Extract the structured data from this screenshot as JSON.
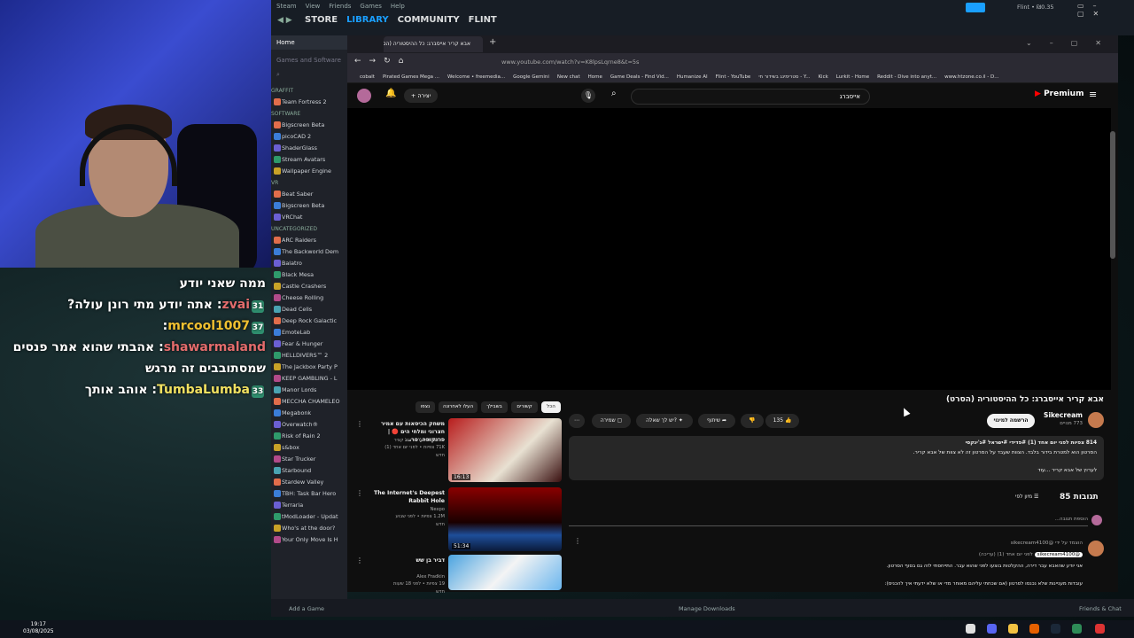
{
  "chat": {
    "lines": [
      {
        "text": "ממה שאני יודע"
      },
      {
        "user": "zvai",
        "badge": "31",
        "text": ": אתה יודע מתי רונן עולה?"
      },
      {
        "user": "mrcool1007",
        "badge": "37",
        "text": ":"
      },
      {
        "user": "shawarmaland",
        "text": ": אהבתי שהוא אמר פנסים"
      },
      {
        "text": "שמסתובבים זה מרגש"
      },
      {
        "user": "TumbaLumba",
        "badge": "33",
        "text": ": אוהב אותך"
      }
    ]
  },
  "steam": {
    "menu": [
      "Steam",
      "View",
      "Friends",
      "Games",
      "Help"
    ],
    "nav": [
      "STORE",
      "LIBRARY",
      "COMMUNITY",
      "FLINT"
    ],
    "user": "Flint • ₪0.35",
    "home": "Home",
    "filter": "Games and Software",
    "categories": [
      {
        "name": "GRAFFIT",
        "items": [
          "Team Fortress 2"
        ]
      },
      {
        "name": "SOFTWARE",
        "count": "(5/5)",
        "items": [
          "Bigscreen Beta",
          "picoCAD 2",
          "ShaderGlass",
          "Stream Avatars",
          "Wallpaper Engine"
        ]
      },
      {
        "name": "VR",
        "count": "(3/3)",
        "items": [
          "Beat Saber",
          "Bigscreen Beta",
          "VRChat"
        ]
      },
      {
        "name": "UNCATEGORIZED",
        "count": "(27/27)",
        "items": [
          "ARC Raiders",
          "The Backworld Dem",
          "Balatro",
          "Black Mesa",
          "Castle Crashers",
          "Cheese Rolling",
          "Dead Cells",
          "Deep Rock Galactic",
          "EmoteLab",
          "Fear & Hunger",
          "HELLDIVERS™ 2",
          "The Jackbox Party P",
          "KEEP GAMBLING - L",
          "Manor Lords",
          "MECCHA CHAMELEO",
          "Megabonk",
          "Overwatch®",
          "Risk of Rain 2",
          "s&box",
          "Star Trucker",
          "Starbound",
          "Stardew Valley",
          "TBH: Task Bar Hero",
          "Terraria",
          "tModLoader - Updat",
          "Who's at the door?",
          "Your Only Move Is H"
        ]
      }
    ],
    "bottom": {
      "add_game": "Add a Game",
      "downloads": "Manage Downloads",
      "friends": "Friends & Chat"
    }
  },
  "browser": {
    "tab_title": "אבא קריר אייסברג: כל ההיסטוריה (הסרט)",
    "url": "www.youtube.com/watch?v=K8lpsLqrne8&t=5s",
    "bookmarks": [
      "cobalt",
      "Pirated Games Mega ...",
      "Welcome • freemedia...",
      "Google Gemini",
      "New chat",
      "Home",
      "Game Deals - Find Vid...",
      "Humanize AI",
      "Flint - YouTube",
      "סטרימינג בשידור חי - Y...",
      "Kick",
      "Lurkit - Home",
      "Reddit - Dive into anyt...",
      "www.htzone.co.il - D..."
    ]
  },
  "youtube": {
    "brand": "Premium",
    "create_label": "יצירה",
    "search_value": "אייסברג",
    "chips": [
      "הכל",
      "קשורים",
      "בשבילך",
      "העלו לאחרונה",
      "נצפו"
    ],
    "video": {
      "title": "אבא קריר אייסברג: כל ההיסטוריה (הסרט)",
      "channel": "Sikecream",
      "subscribers": "773 מנויים",
      "subscribe_label": "הרשמה למינוי",
      "likes": "135",
      "share_label": "שיתוף",
      "ask_label": "יש לך שאלה?",
      "save_label": "שמירה",
      "desc_meta": "814 צפיות  לפני יום אחד (1)  #פדידי #ישראל #ג'ינקסי",
      "desc_line": "הסרטון הוא למטרת בידור בלבד. הצוות שעבד על הסרטון זה לא צוות של אבא קריר.",
      "desc_more": "לערוץ של אבא קריר ...עוד"
    },
    "comments": {
      "count": "85 תגובות",
      "sort_label": "מיון לפי",
      "add_placeholder": "הוספת תגובה...",
      "pinned": "הוצמד על ידי @sikecream4100",
      "author": "@sikecream4100",
      "time": "לפני יום אחד (1) (עריכה)",
      "line1": "אני יודע שהאבא עבר דירה, ההקלטות בוצעו לפני שהוא עבר. התייחסתי לזה גם בסוף הסרטון.",
      "line2": "עובדות מעניינות שלא נכנסו לסרטון (אם שכחתי עליהם מאוחר מדי או שלא ידעתי איך להכניס):"
    },
    "recommendations": [
      {
        "title": "משחק הכיסאות עם אמיר חצרוני ומלחי הים 🔴 | פרנקופה, פר...",
        "channel": "Yuval Katzir • יובל קציר",
        "meta": "71K צפיות • לפני יום אחד (1)",
        "badge": "חדש",
        "duration": "16:13"
      },
      {
        "title": "The Internet's Deepest Rabbit Hole",
        "channel": "Nexpo",
        "meta": "1.2M צפיות • לפני שבוע",
        "badge": "חדש",
        "duration": "51:34"
      },
      {
        "title": "דביר בן שש",
        "channel": "Alex Fradkin",
        "meta": "19 צפיות • לפני 18 שעות",
        "badge": "חדש",
        "duration": ""
      }
    ]
  },
  "taskbar": {
    "time": "19:17",
    "date": "03/08/2025"
  }
}
